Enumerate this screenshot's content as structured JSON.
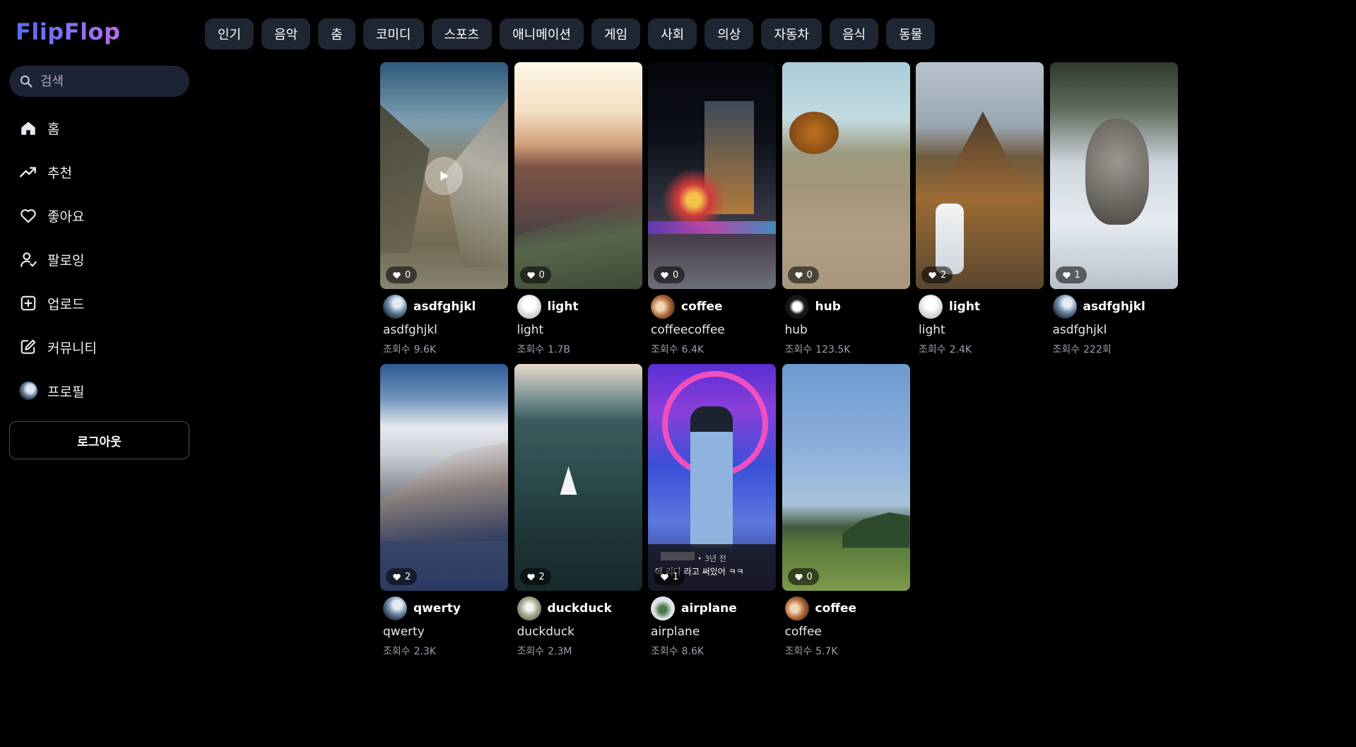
{
  "app": {
    "logo": "FlipFlop"
  },
  "search": {
    "placeholder": "검색"
  },
  "nav": [
    {
      "label": "홈",
      "icon": "home-icon"
    },
    {
      "label": "추천",
      "icon": "trending-icon"
    },
    {
      "label": "좋아요",
      "icon": "heart-icon"
    },
    {
      "label": "팔로잉",
      "icon": "following-icon"
    },
    {
      "label": "업로드",
      "icon": "upload-icon"
    },
    {
      "label": "커뮤니티",
      "icon": "edit-icon"
    },
    {
      "label": "프로필",
      "icon": "avatar"
    }
  ],
  "logout_label": "로그아웃",
  "categories": [
    "인기",
    "음악",
    "춤",
    "코미디",
    "스포츠",
    "애니메이션",
    "게임",
    "사회",
    "의상",
    "자동차",
    "음식",
    "동물"
  ],
  "views_label": "조회수",
  "videos": [
    {
      "author": "asdfghjkl",
      "title": "asdfghjkl",
      "views": "9.6K",
      "likes": "0"
    },
    {
      "author": "light",
      "title": "light",
      "views": "1.7B",
      "likes": "0"
    },
    {
      "author": "coffee",
      "title": "coffeecoffee",
      "views": "6.4K",
      "likes": "0"
    },
    {
      "author": "hub",
      "title": "hub",
      "views": "123.5K",
      "likes": "0"
    },
    {
      "author": "light",
      "title": "light",
      "views": "2.4K",
      "likes": "2"
    },
    {
      "author": "asdfghjkl",
      "title": "asdfghjkl",
      "views": "222회",
      "likes": "1"
    },
    {
      "author": "qwerty",
      "title": "qwerty",
      "views": "2.3K",
      "likes": "2"
    },
    {
      "author": "duckduck",
      "title": "duckduck",
      "views": "2.3M",
      "likes": "2"
    },
    {
      "author": "airplane",
      "title": "airplane",
      "views": "8.6K",
      "likes": "1"
    },
    {
      "author": "coffee",
      "title": "coffee",
      "views": "5.7K",
      "likes": "0"
    }
  ],
  "overlay": {
    "meta": "• 3년 전",
    "line": "에 리다 라고 써있어 ㅋㅋ"
  }
}
